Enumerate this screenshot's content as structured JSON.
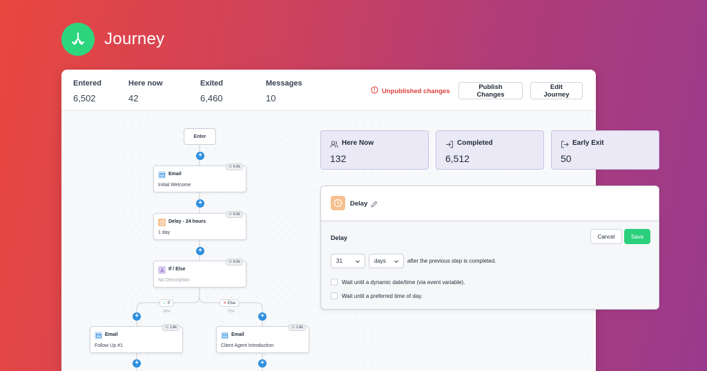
{
  "app": {
    "title": "Journey"
  },
  "stats": [
    {
      "label": "Entered",
      "value": "6,502"
    },
    {
      "label": "Here now",
      "value": "42"
    },
    {
      "label": "Exited",
      "value": "6,460"
    },
    {
      "label": "Messages",
      "value": "10"
    }
  ],
  "header": {
    "unpublished": "Unpublished changes",
    "publish_label": "Publish Changes",
    "edit_label": "Edit Journey"
  },
  "flow": {
    "enter": "Enter",
    "nodes": [
      {
        "title": "Email",
        "subtitle": "Initial Welcome",
        "count": "6.5k"
      },
      {
        "title": "Delay - 24 hours",
        "subtitle": "1 day",
        "count": "6.5k"
      },
      {
        "title": "If / Else",
        "subtitle": "No Description",
        "count": "6.5k"
      },
      {
        "title": "Email",
        "subtitle": "Follow Up #1",
        "count": "1.8k"
      },
      {
        "title": "Email",
        "subtitle": "Client Agent Introduction",
        "count": "1.8k"
      }
    ],
    "branch_if": {
      "label": "If",
      "pct": "28%"
    },
    "branch_else": {
      "label": "Else",
      "pct": "72%"
    }
  },
  "metrics": [
    {
      "label": "Here Now",
      "value": "132"
    },
    {
      "label": "Completed",
      "value": "6,512"
    },
    {
      "label": "Early Exit",
      "value": "50"
    }
  ],
  "editor": {
    "title": "Delay",
    "field_label": "Delay",
    "cancel_label": "Cancel",
    "save_label": "Save",
    "amount": "31",
    "unit": "days",
    "after_text": "after the previous step is completed.",
    "option_dynamic": "Wait until a dynamic date/time (via event variable).",
    "option_preferred": "Wait until a preferred time of day."
  },
  "colors": {
    "brand_green": "#2dd57f",
    "warning_red": "#dc3f3a",
    "connector_blue": "#2f8fe0",
    "metric_bg": "#ebe9f6"
  }
}
